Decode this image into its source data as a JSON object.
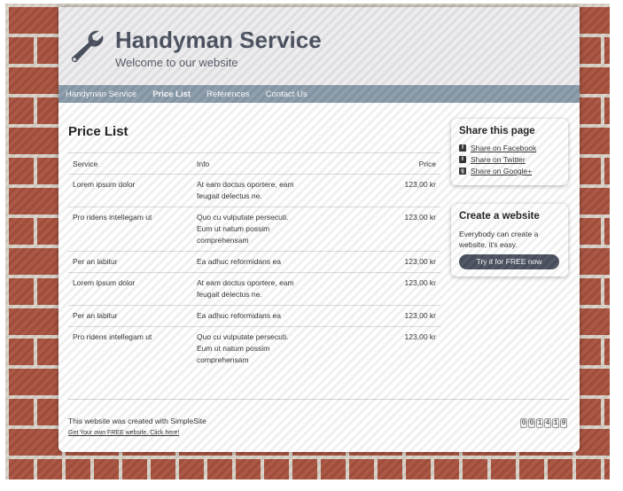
{
  "site": {
    "title": "Handyman Service",
    "subtitle": "Welcome to our website",
    "logo_icon": "wrench-icon"
  },
  "nav": {
    "items": [
      {
        "label": "Handyman Service",
        "active": false
      },
      {
        "label": "Price List",
        "active": true
      },
      {
        "label": "References",
        "active": false
      },
      {
        "label": "Contact Us",
        "active": false
      }
    ]
  },
  "content": {
    "title": "Price List",
    "table": {
      "headers": [
        "Service",
        "Info",
        "Price"
      ],
      "rows": [
        {
          "service": "Lorem ipsum dolor",
          "info": [
            "At eam doctus oportere, eam",
            "feugait delectus ne."
          ],
          "price": "123,00 kr"
        },
        {
          "service": "Pro ridens intellegam ut",
          "info": [
            "Quo cu vulputate persecuti.",
            "Eum ut natum possim",
            "comprehensam"
          ],
          "price": "123,00 kr"
        },
        {
          "service": "Per an labitur",
          "info": [
            "Ea adhuc reformidans ea"
          ],
          "price": "123,00 kr"
        },
        {
          "service": "Lorem ipsum dolor",
          "info": [
            "At eam doctus oportere, eam",
            "feugait delectus ne."
          ],
          "price": "123,00 kr"
        },
        {
          "service": "Per an labitur",
          "info": [
            "Ea adhuc reformidans ea"
          ],
          "price": "123,00 kr"
        },
        {
          "service": "Pro ridens intellegam ut",
          "info": [
            "Quo cu vulputate persecuti.",
            "Eum ut natum possim",
            "comprehensam"
          ],
          "price": "123,00 kr"
        }
      ]
    }
  },
  "share": {
    "title": "Share this page",
    "links": [
      {
        "label": "Share on Facebook",
        "icon": "facebook-icon",
        "glyph": "f"
      },
      {
        "label": "Share on Twitter",
        "icon": "twitter-icon",
        "glyph": "t"
      },
      {
        "label": "Share on Google+",
        "icon": "google-plus-icon",
        "glyph": "g"
      }
    ]
  },
  "create": {
    "title": "Create a website",
    "text": "Everybody can create a website, it's easy.",
    "button": "Try it for FREE now"
  },
  "footer": {
    "text": "This website was created with SimpleSite",
    "link": "Get Your own FREE website. Click here!",
    "counter": [
      "0",
      "0",
      "1",
      "4",
      "1",
      "9"
    ]
  },
  "colors": {
    "header_bg": "#ececee",
    "nav_bg": "#8a9bab",
    "title_color": "#4b5160",
    "button_bg": "#4b5160"
  }
}
